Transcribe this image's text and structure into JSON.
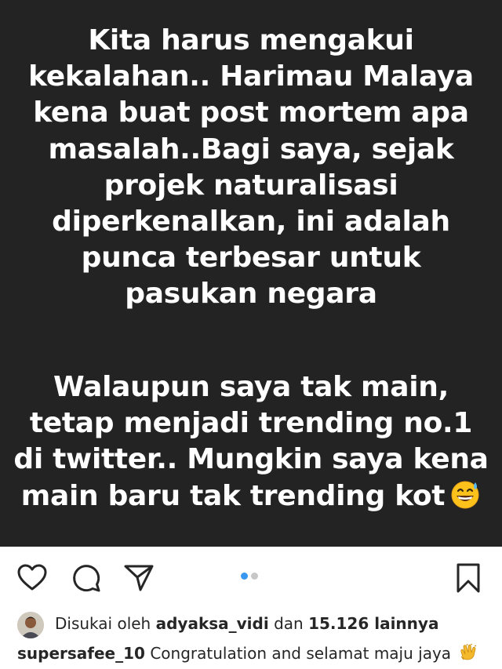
{
  "post": {
    "caption_block_1": [
      "Kita harus mengakui",
      "kekalahan.. Harimau Malaya",
      "kena buat post mortem apa",
      "masalah..Bagi saya, sejak",
      "projek naturalisasi",
      "diperkenalkan, ini adalah",
      "punca terbesar untuk",
      "pasukan negara"
    ],
    "caption_block_2": [
      "Walaupun saya tak main,",
      "tetap menjadi trending no.1",
      "di twitter.. Mungkin saya kena",
      "main baru tak trending kot"
    ],
    "emoji": "grinning-face-with-sweat-icon",
    "background_color": "#232323",
    "text_color": "#ffffff"
  },
  "carousel": {
    "current_index": 1,
    "total": 2,
    "active_color": "#3897f0",
    "inactive_color": "#c7c7c7"
  },
  "actions": {
    "like_icon": "heart-icon",
    "comment_icon": "comment-icon",
    "share_icon": "send-icon",
    "save_icon": "bookmark-icon"
  },
  "likes": {
    "prefix": "Disukai oleh",
    "user": "adyaksa_vidi",
    "connector": "dan",
    "others": "15.126 lainnya"
  },
  "caption": {
    "username": "supersafee_10",
    "text": "Congratulation and selamat maju jaya",
    "emoji": "clapping-hands-icon"
  }
}
